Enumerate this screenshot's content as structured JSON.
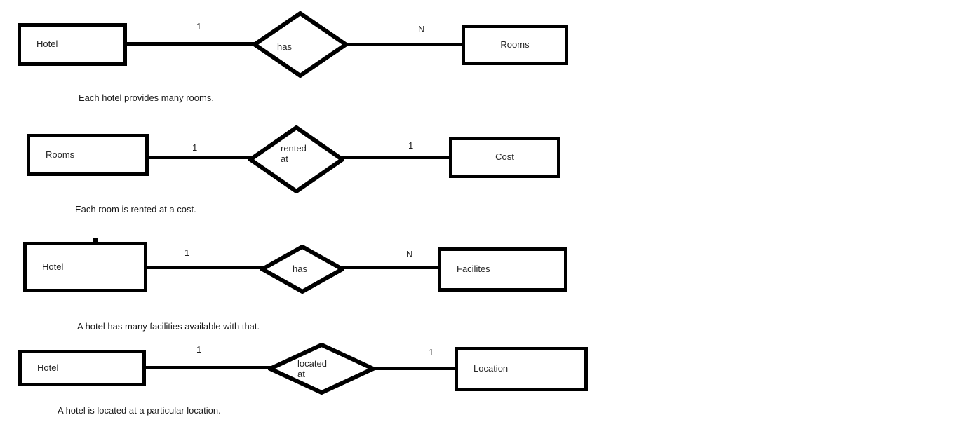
{
  "document": {
    "title": "Hotel ER Diagram",
    "background_color": "#ffffff",
    "stroke_color": "#000000",
    "text_color": "#262626"
  },
  "relationships": [
    {
      "id": "hotel-has-rooms",
      "left_entity": "Hotel",
      "left_cardinality": "1",
      "relationship": "has",
      "right_cardinality": "N",
      "right_entity": "Rooms",
      "caption": "Each hotel provides many rooms."
    },
    {
      "id": "rooms-rented-at-cost",
      "left_entity": "Rooms",
      "left_cardinality": "1",
      "relationship": "rented\nat",
      "right_cardinality": "1",
      "right_entity": "Cost",
      "caption": "Each room is rented at a cost."
    },
    {
      "id": "hotel-has-facilites",
      "left_entity": "Hotel",
      "left_cardinality": "1",
      "relationship": "has",
      "right_cardinality": "N",
      "right_entity": "Facilites",
      "caption": "A hotel has many facilities available with that."
    },
    {
      "id": "hotel-located-at-location",
      "left_entity": "Hotel",
      "left_cardinality": "1",
      "relationship": "located\nat",
      "right_cardinality": "1",
      "right_entity": "Location",
      "caption": "A hotel is located at a particular location."
    }
  ]
}
